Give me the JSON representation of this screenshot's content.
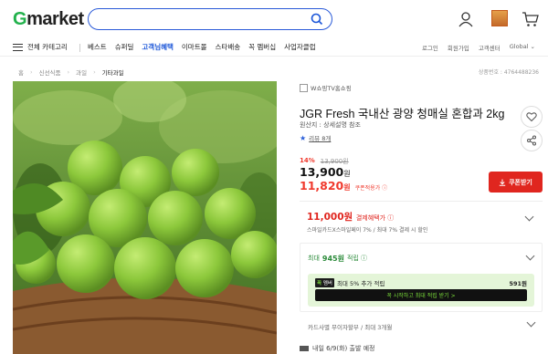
{
  "header": {
    "logo_g": "G",
    "logo_rest": "market",
    "search_placeholder": "",
    "icons": [
      "search-icon",
      "user-icon",
      "recent-view-icon",
      "cart-icon"
    ]
  },
  "nav": {
    "menu_label": "전체 카테고리",
    "links": [
      "베스트",
      "슈퍼딜",
      "고객님혜택",
      "이마트몰",
      "스타배송",
      "꼭 멤버십",
      "사업자클럽"
    ],
    "active_index": 2,
    "util": [
      "로그인",
      "회원가입",
      "고객센터",
      "Global ⌄"
    ]
  },
  "breadcrumb": [
    "홈",
    "신선식품",
    "과일",
    "기타과일"
  ],
  "product_no": "상품번호 : 4764488236",
  "product": {
    "seller": "W쇼핑TV홈쇼핑",
    "title": "JGR Fresh 국내산 광양 청매실 혼합과 2kg",
    "origin": "원산지 : 상세설명 참조",
    "review": "리뷰 8개",
    "discount_pct": "14%",
    "orig_price": "13,900원",
    "price": "13,900",
    "price_unit": "원",
    "coupon_price": "11,820",
    "coupon_unit": "원",
    "coupon_note": "쿠폰적용가 ⓘ",
    "coupon_button": "쿠폰받기"
  },
  "payment": {
    "amount": "11,000원",
    "label": "결제혜택가 ⓘ",
    "sub": "스마일카드X스마일페이 7% / 최대 7% 결제 시 할인"
  },
  "points": {
    "prefix": "최대",
    "amount": "945원",
    "suffix": "적립 ⓘ",
    "tag_a": "꼭",
    "tag_b": "멤버",
    "line": "최대 5% 추가 적립",
    "pts": "591원",
    "cta": "꼭 시작하고 최대 적립 받기 >"
  },
  "card_line": "카드사별 무이자할부 / 최대 3개월",
  "shipping": "내일 6/9(화) 출발 예정"
}
